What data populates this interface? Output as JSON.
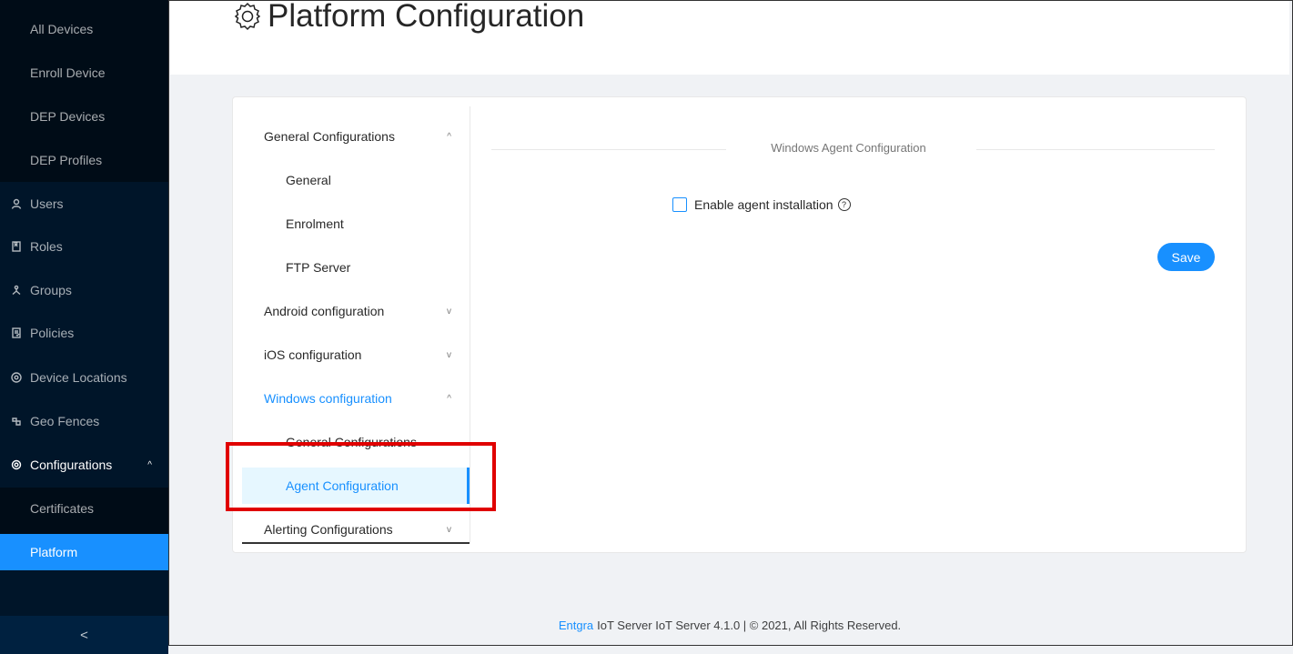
{
  "sidebar": {
    "items": [
      {
        "label": "All Devices"
      },
      {
        "label": "Enroll Device"
      },
      {
        "label": "DEP Devices"
      },
      {
        "label": "DEP Profiles"
      },
      {
        "label": "Users",
        "icon": "user-icon"
      },
      {
        "label": "Roles",
        "icon": "book-icon"
      },
      {
        "label": "Groups",
        "icon": "cluster-icon"
      },
      {
        "label": "Policies",
        "icon": "audit-icon"
      },
      {
        "label": "Device Locations",
        "icon": "environment-icon"
      },
      {
        "label": "Geo Fences",
        "icon": "gateway-icon"
      },
      {
        "label": "Configurations",
        "icon": "setting-icon",
        "caret": "^"
      },
      {
        "label": "Certificates"
      },
      {
        "label": "Platform"
      }
    ],
    "collapse_glyph": "<"
  },
  "header": {
    "title": "Platform Configuration",
    "icon": "setting-icon"
  },
  "menu": {
    "items": [
      {
        "label": "General Configurations",
        "caret": "^"
      },
      {
        "label": "General"
      },
      {
        "label": "Enrolment"
      },
      {
        "label": "FTP Server"
      },
      {
        "label": "Android configuration",
        "caret": "v"
      },
      {
        "label": "iOS configuration",
        "caret": "v"
      },
      {
        "label": "Windows configuration",
        "caret": "^"
      },
      {
        "label": "General Configurations"
      },
      {
        "label": "Agent Configuration"
      },
      {
        "label": "Alerting Configurations",
        "caret": "v"
      }
    ]
  },
  "content": {
    "section_title": "Windows Agent Configuration",
    "checkbox_label": "Enable agent installation",
    "help_glyph": "?",
    "save_label": "Save"
  },
  "footer": {
    "brand": "Entgra",
    "text": "IoT Server IoT Server 4.1.0 | © 2021, All Rights Reserved."
  },
  "colors": {
    "sidebar_bg": "#001529",
    "primary": "#1890ff",
    "highlight": "#e00000"
  }
}
